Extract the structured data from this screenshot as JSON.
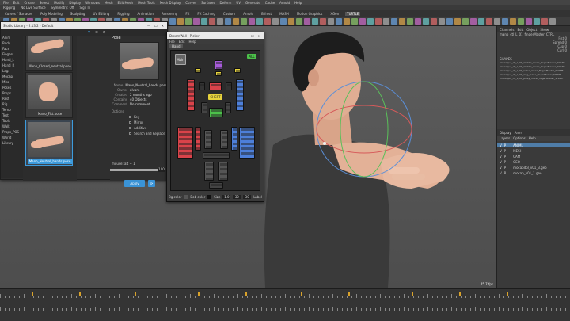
{
  "menubar": [
    "File",
    "Edit",
    "Create",
    "Select",
    "Modify",
    "Display",
    "Windows",
    "Mesh",
    "Edit Mesh",
    "Mesh Tools",
    "Mesh Display",
    "Curves",
    "Surfaces",
    "Deform",
    "UV",
    "Generate",
    "Cache",
    "Arnold",
    "Help"
  ],
  "shelfbar": [
    "Rigging",
    "No Live Surface",
    "Symmetry: Off",
    "Sign In"
  ],
  "shelftabs": [
    {
      "label": "Curves / Surfaces",
      "active": false
    },
    {
      "label": "Poly Modeling",
      "active": false
    },
    {
      "label": "Sculpting",
      "active": false
    },
    {
      "label": "UV Editing",
      "active": false
    },
    {
      "label": "Rigging",
      "active": false
    },
    {
      "label": "Animation",
      "active": false
    },
    {
      "label": "Rendering",
      "active": false
    },
    {
      "label": "FX",
      "active": false
    },
    {
      "label": "FX Caching",
      "active": false
    },
    {
      "label": "Custom",
      "active": false
    },
    {
      "label": "Arnold",
      "active": false
    },
    {
      "label": "Bifrost",
      "active": false
    },
    {
      "label": "MASH",
      "active": false
    },
    {
      "label": "Motion Graphics",
      "active": false
    },
    {
      "label": "XGen",
      "active": false
    },
    {
      "label": "TURTLE",
      "active": true
    }
  ],
  "pose_window": {
    "title": "Studio Library - 2.13.2 - Default",
    "folders": [
      "Anim",
      "Body",
      "Face",
      "Fingers",
      "Hand_L",
      "Hand_R",
      "Legs",
      "Mocap",
      "Misc",
      "Poses",
      "Props",
      "Rest",
      "Rig",
      "Temp",
      "Test",
      "Tools",
      "Walk",
      "Props_POS",
      "World",
      "Library"
    ],
    "poses": [
      {
        "label": "Mano_Closed_neutral.pose",
        "selected": false
      },
      {
        "label": "Mano_Fist.pose",
        "selected": false
      },
      {
        "label": "Mano_Neutral_hands.pose",
        "selected": true
      }
    ],
    "detail": {
      "header": "Pose",
      "meta": [
        {
          "k": "Name",
          "v": "Mano_Neutral_hands.pose"
        },
        {
          "k": "Owner",
          "v": "alvaro"
        },
        {
          "k": "Created",
          "v": "2 months ago"
        },
        {
          "k": "Contains",
          "v": "40 Objects"
        },
        {
          "k": "Comment",
          "v": "No comment"
        }
      ],
      "options_header": "Options",
      "options": [
        {
          "label": "Key",
          "on": true
        },
        {
          "label": "Mirror",
          "on": false
        },
        {
          "label": "Additive",
          "on": false
        },
        {
          "label": "Search and Replace",
          "on": false
        }
      ],
      "blend_label": "mouse: alt + 1",
      "blend_value": "100",
      "blend_fraction": 1.0,
      "apply_label": "Apply"
    }
  },
  "picker_window": {
    "title": "DreamWall - Picker",
    "menu": [
      "File",
      "Edit",
      "Help"
    ],
    "tab": "Hand",
    "main_label": "Main",
    "all_label": "ALL",
    "chest_label": "CHEST",
    "bottom": {
      "bg_color_label": "Bg color",
      "bob_color_label": "Bob color",
      "size_label": "Size",
      "size_value": "1.0",
      "w": "30",
      "h": "30",
      "label": "Label"
    }
  },
  "viewport": {
    "fps": "45.7 fps"
  },
  "channel_box": {
    "tabs": [
      "Channels",
      "Edit",
      "Object",
      "Show"
    ],
    "selected": "mano_ctl_L_01_fingerMaster_CTRL",
    "attrs": [
      "Fist 0",
      "Spread 0",
      "Cup 0",
      "Curl 0"
    ],
    "shapes_label": "SHAPES",
    "shape_items": [
      "manoqua_ctl_L_01_middle_mano_fingerMaster_SHAPE",
      "manoqua_ctl_L_01_middle_mano_fingerMaster_SHAPE",
      "manoqua_ctl_L_01_index_mano_fingerMaster_SHAPE",
      "manoqua_ctl_L_01_ring_mano_fingerMaster_SHAPE",
      "manoqua_ctl_L_01_pinky_mano_fingerMaster_SHAPE"
    ],
    "layer_tabs": [
      "Display",
      "Anim"
    ],
    "layer_sub": [
      "Layers",
      "Options",
      "Help"
    ],
    "layers": [
      {
        "name": "ANIM1",
        "sel": true
      },
      {
        "name": "MESH",
        "sel": false
      },
      {
        "name": "CAM",
        "sel": false
      },
      {
        "name": "GEO",
        "sel": false
      },
      {
        "name": "mocapdpl_v01_3.geo",
        "sel": false
      },
      {
        "name": "mocap_v01_1.geo",
        "sel": false
      }
    ]
  },
  "colors": {
    "accent": "#3d9bdc",
    "key": "#d9a22a",
    "red": "#d9434a",
    "blue": "#4d7fd9",
    "yellow": "#e6d23c",
    "green": "#4cc04a",
    "purple": "#a65bd9"
  }
}
